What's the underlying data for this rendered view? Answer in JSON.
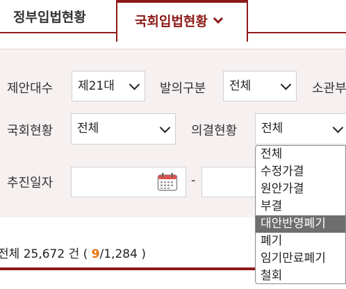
{
  "tabs": [
    {
      "label": "정부입법현황"
    },
    {
      "label": "국회입법현황",
      "icon": "chevron-down-icon"
    }
  ],
  "filters": {
    "proposal_session": {
      "label": "제안대수",
      "value": "제21대"
    },
    "proposer_type": {
      "label": "발의구분",
      "value": "전체"
    },
    "committee": {
      "label": "소관부"
    },
    "assembly_status": {
      "label": "국회현황",
      "value": "전체"
    },
    "resolution_status": {
      "label": "의결현황",
      "value": "전체"
    },
    "date": {
      "label": "추진일자",
      "from": "",
      "to": "",
      "separator": "-"
    }
  },
  "resolution_options": [
    "전체",
    "수정가결",
    "원안가결",
    "부결",
    "대안반영폐기",
    "폐기",
    "임기만료폐기",
    "철회"
  ],
  "highlighted_option": "대안반영폐기",
  "summary": {
    "total_label": "전체",
    "total_count": "25,672",
    "count_unit": "건",
    "open_paren": "(",
    "current_page": "9",
    "total_pages": "/1,284",
    "close_paren": ")"
  },
  "colors": {
    "accent": "#8c1a17",
    "highlight": "#e8730b",
    "panel_bg": "#f6f0f0",
    "selected_option_bg": "#6e6e6e"
  }
}
